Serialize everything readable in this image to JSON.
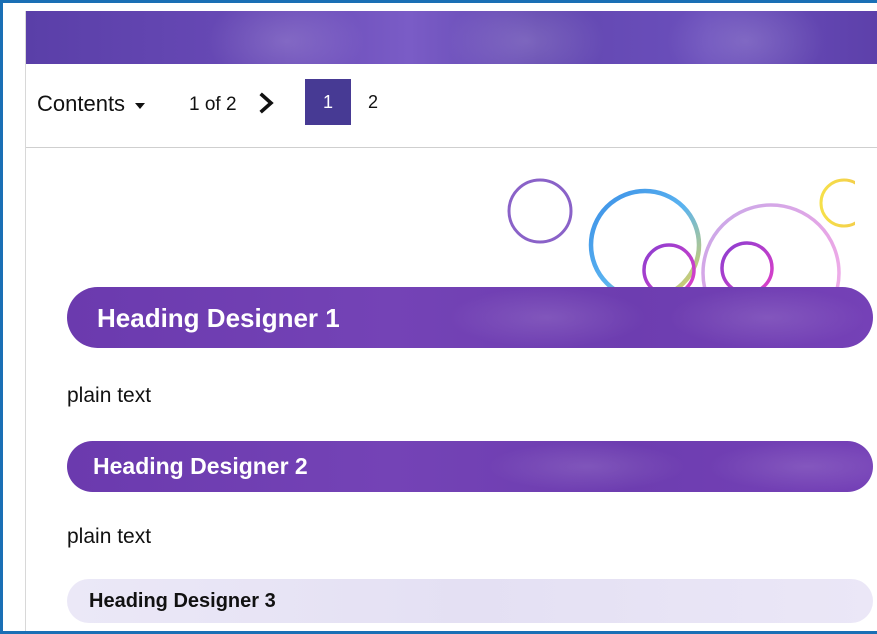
{
  "toolbar": {
    "contents_label": "Contents",
    "page_count": "1 of 2",
    "pages": [
      "1",
      "2"
    ],
    "active_page": "1"
  },
  "content": {
    "heading1": "Heading Designer 1",
    "text1": "plain text",
    "heading2": "Heading Designer 2",
    "text2": "plain text",
    "heading3": "Heading Designer 3"
  },
  "colors": {
    "frame_border": "#1a6fb5",
    "banner": "#6247b0",
    "active_page_bg": "#473a94",
    "heading_purple": "#7041b4",
    "heading_light": "#e8e5f5"
  },
  "icons": {
    "contents_caret": "caret-down-icon",
    "next_page": "chevron-right-icon",
    "decoration": "circles-decoration"
  }
}
